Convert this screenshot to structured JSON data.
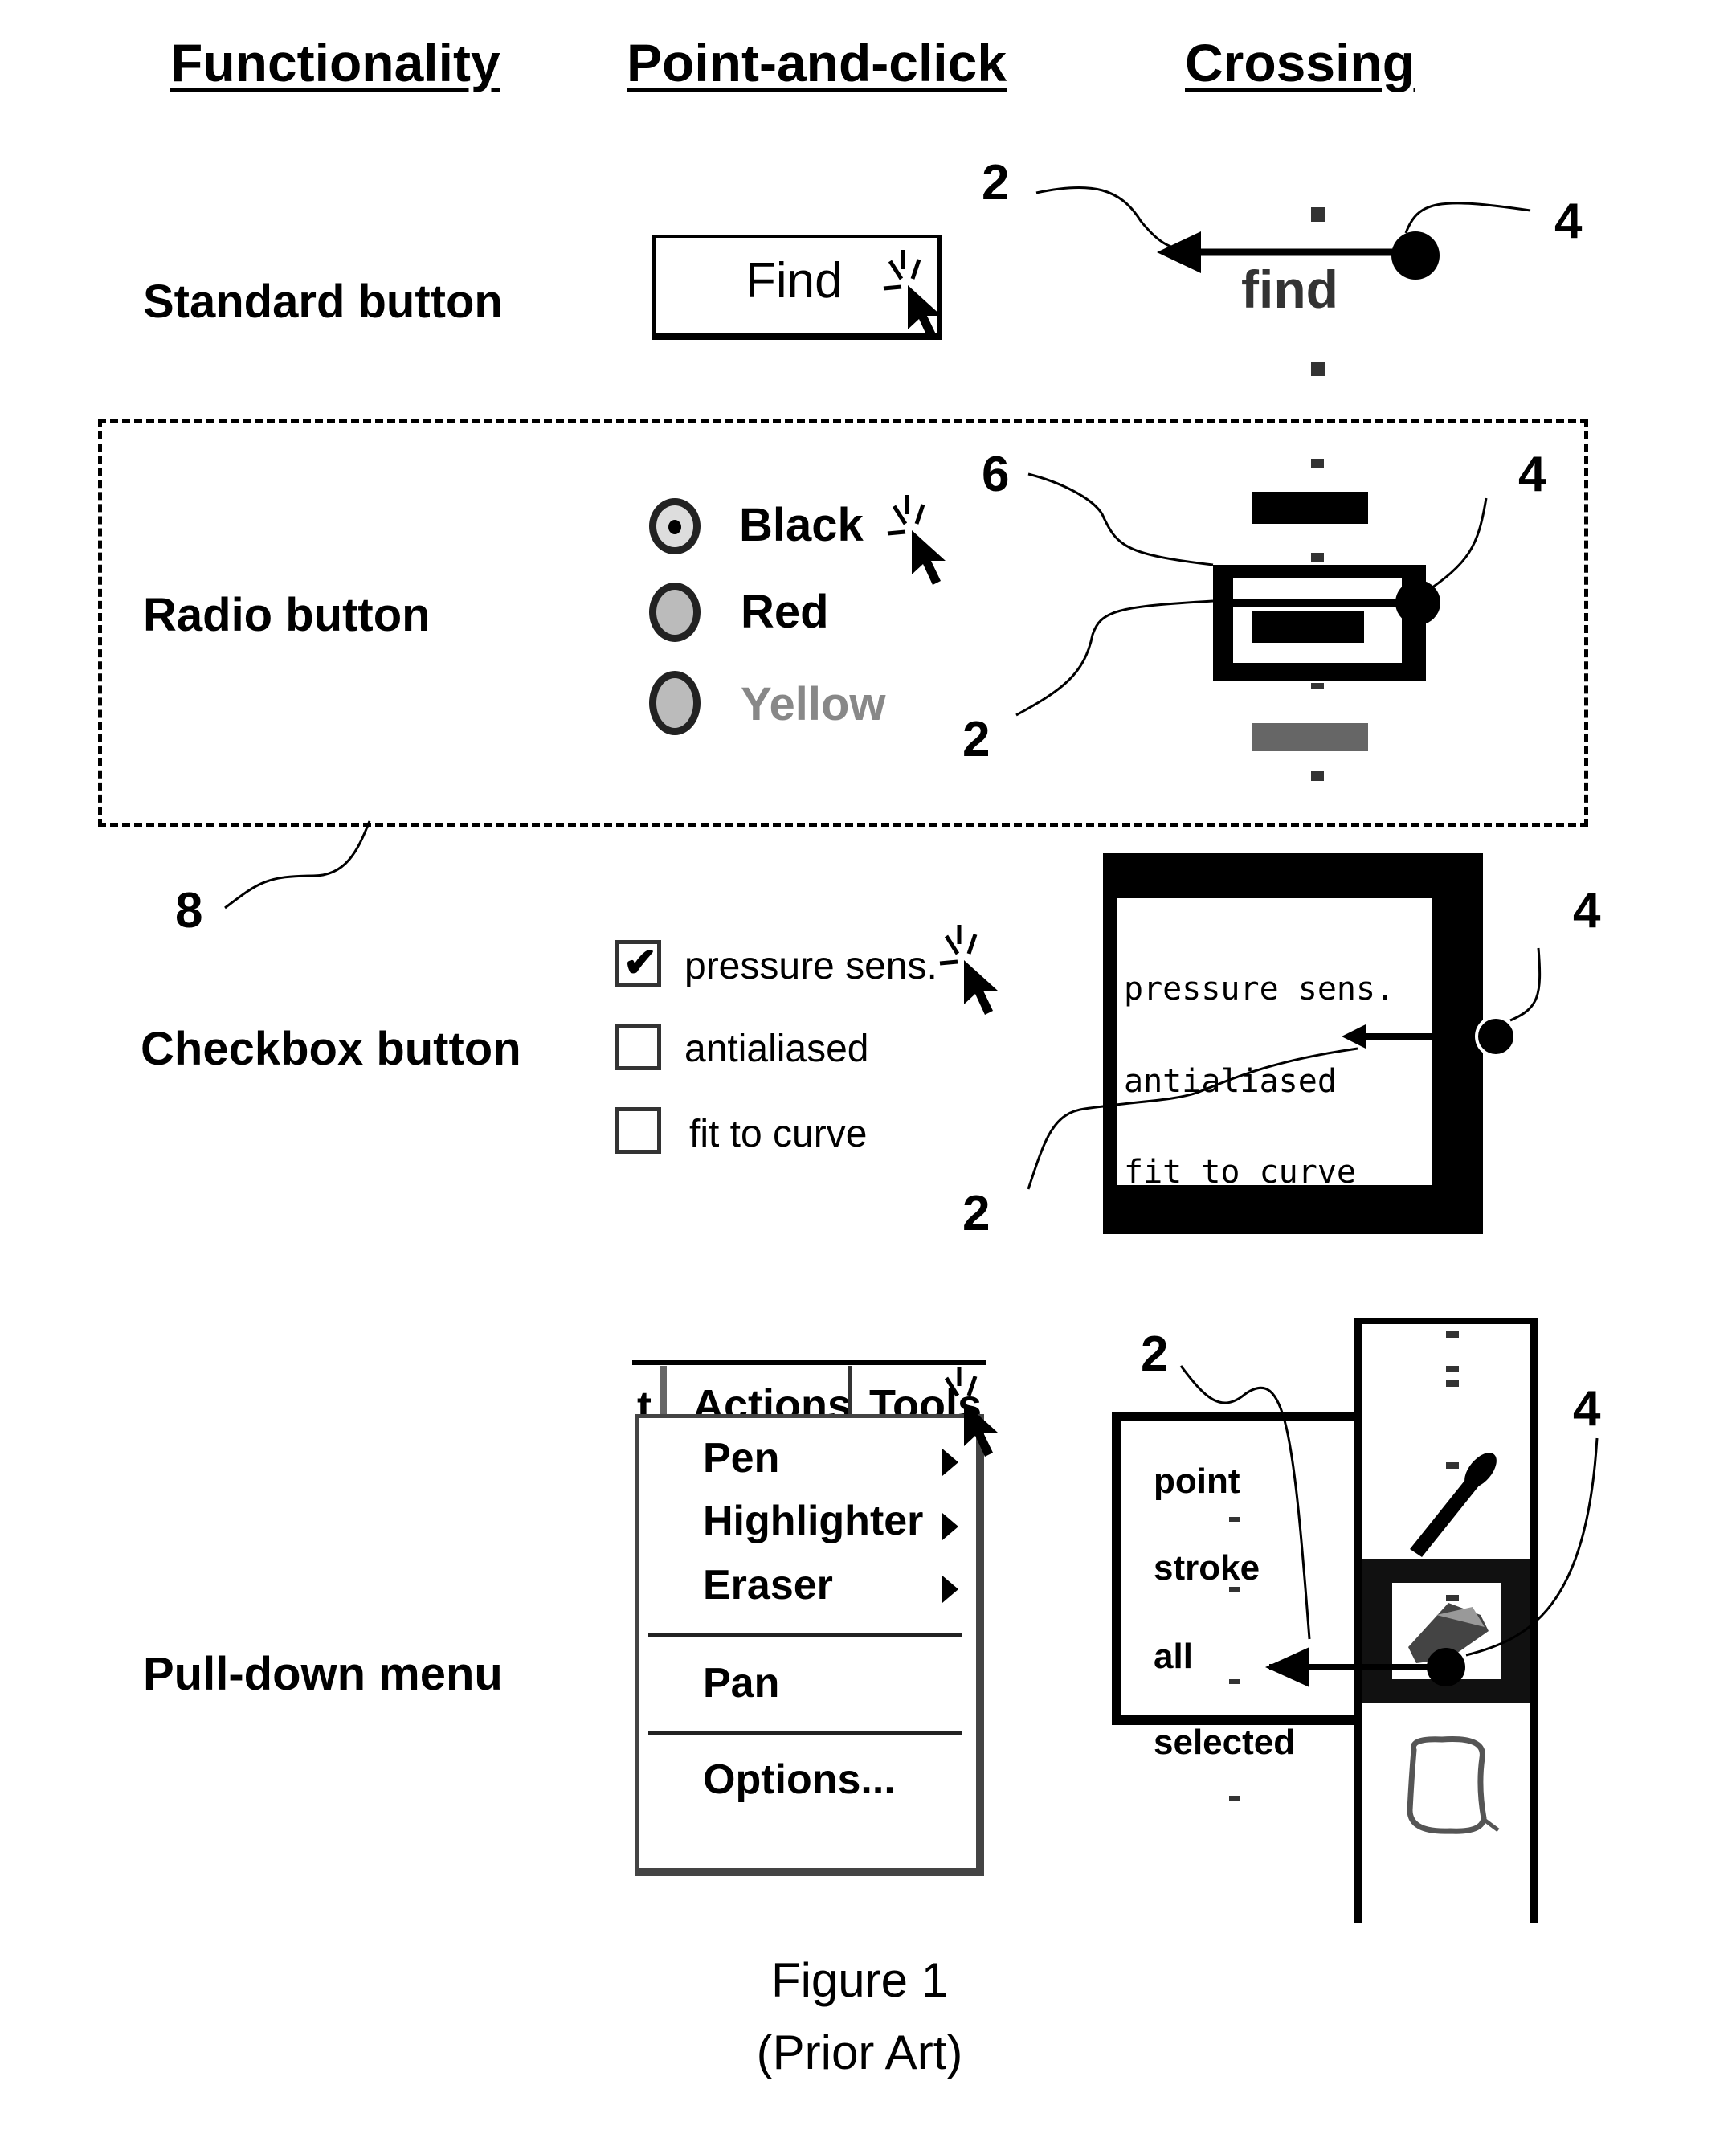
{
  "headers": {
    "functionality": "Functionality",
    "point_and_click": "Point-and-click",
    "crossing": "Crossing"
  },
  "rows": {
    "standard_button": {
      "label": "Standard button",
      "button_text": "Find",
      "crossing_text": "find"
    },
    "radio_button": {
      "label": "Radio button",
      "options": [
        "Black",
        "Red",
        "Yellow"
      ],
      "selected": "Black"
    },
    "checkbox_button": {
      "label": "Checkbox button",
      "options": [
        {
          "label": "pressure sens.",
          "checked": true
        },
        {
          "label": "antialiased",
          "checked": false
        },
        {
          "label": "fit to curve",
          "checked": false
        }
      ],
      "crossing_options": [
        "pressure sens.",
        "antialiased",
        "fit to curve"
      ]
    },
    "pulldown_menu": {
      "label": "Pull-down menu",
      "menubar": {
        "prev": "t",
        "active": "Actions",
        "next": "Tools"
      },
      "items": [
        {
          "label": "Pen",
          "submenu": true
        },
        {
          "label": "Highlighter",
          "submenu": true
        },
        {
          "label": "Eraser",
          "submenu": true
        },
        {
          "label": "Pan",
          "submenu": false
        },
        {
          "label": "Options...",
          "submenu": false
        }
      ],
      "crossing_items": [
        "point",
        "stroke",
        "all",
        "selected"
      ]
    }
  },
  "refs": {
    "r2": "2",
    "r4": "4",
    "r6": "6",
    "r8": "8"
  },
  "caption": {
    "line1": "Figure 1",
    "line2": "(Prior Art)"
  }
}
